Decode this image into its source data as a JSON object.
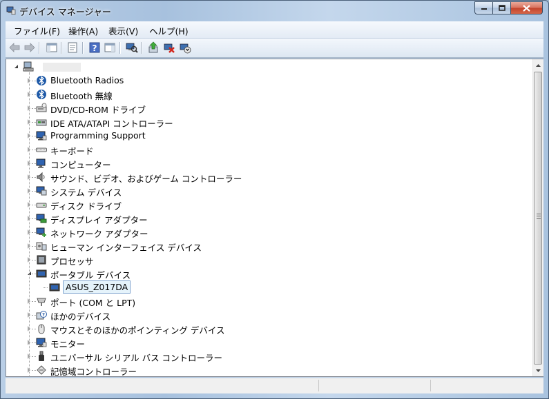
{
  "window": {
    "title": "デバイス マネージャー",
    "controls": {
      "minimize_icon": "minimize-icon",
      "maximize_icon": "maximize-icon",
      "close_icon": "close-icon"
    }
  },
  "menu": [
    {
      "id": "file",
      "label": "ファイル(F)"
    },
    {
      "id": "action",
      "label": "操作(A)"
    },
    {
      "id": "view",
      "label": "表示(V)"
    },
    {
      "id": "help",
      "label": "ヘルプ(H)"
    }
  ],
  "toolbar": [
    {
      "id": "back",
      "icon": "back-arrow-icon"
    },
    {
      "id": "forward",
      "icon": "forward-arrow-icon"
    },
    {
      "id": "show-hide-console-tree",
      "icon": "console-tree-icon"
    },
    {
      "id": "properties",
      "icon": "properties-icon"
    },
    {
      "id": "help",
      "icon": "help-icon"
    },
    {
      "id": "show-action-pane",
      "icon": "action-pane-icon"
    },
    {
      "id": "scan-hardware",
      "icon": "scan-hardware-icon"
    },
    {
      "id": "update-driver",
      "icon": "update-driver-icon"
    },
    {
      "id": "uninstall",
      "icon": "uninstall-icon"
    },
    {
      "id": "enable-device",
      "icon": "enable-device-icon"
    }
  ],
  "tree": {
    "root_label": "",
    "items": [
      {
        "label": "Bluetooth Radios",
        "icon": "bluetooth-icon",
        "state": "collapsed"
      },
      {
        "label": "Bluetooth 無線",
        "icon": "bluetooth-icon",
        "state": "collapsed"
      },
      {
        "label": "DVD/CD-ROM ドライブ",
        "icon": "dvd-drive-icon",
        "state": "collapsed"
      },
      {
        "label": "IDE ATA/ATAPI コントローラー",
        "icon": "ide-controller-icon",
        "state": "collapsed"
      },
      {
        "label": "Programming Support",
        "icon": "monitor-icon",
        "state": "collapsed"
      },
      {
        "label": "キーボード",
        "icon": "keyboard-icon",
        "state": "collapsed"
      },
      {
        "label": "コンピューター",
        "icon": "computer-icon",
        "state": "collapsed"
      },
      {
        "label": "サウンド、ビデオ、およびゲーム コントローラー",
        "icon": "speaker-icon",
        "state": "collapsed"
      },
      {
        "label": "システム デバイス",
        "icon": "system-device-icon",
        "state": "collapsed"
      },
      {
        "label": "ディスク ドライブ",
        "icon": "disk-drive-icon",
        "state": "collapsed"
      },
      {
        "label": "ディスプレイ アダプター",
        "icon": "display-adapter-icon",
        "state": "collapsed"
      },
      {
        "label": "ネットワーク アダプター",
        "icon": "network-adapter-icon",
        "state": "collapsed"
      },
      {
        "label": "ヒューマン インターフェイス デバイス",
        "icon": "hid-icon",
        "state": "collapsed"
      },
      {
        "label": "プロセッサ",
        "icon": "processor-icon",
        "state": "collapsed"
      },
      {
        "label": "ポータブル デバイス",
        "icon": "portable-device-icon",
        "state": "expanded"
      },
      {
        "label": "ASUS_Z017DA",
        "icon": "portable-device-icon",
        "state": "child",
        "selected": true
      },
      {
        "label": "ポート (COM と LPT)",
        "icon": "port-icon",
        "state": "collapsed"
      },
      {
        "label": "ほかのデバイス",
        "icon": "unknown-device-icon",
        "state": "collapsed"
      },
      {
        "label": "マウスとそのほかのポインティング デバイス",
        "icon": "mouse-icon",
        "state": "collapsed"
      },
      {
        "label": "モニター",
        "icon": "monitor-icon",
        "state": "collapsed"
      },
      {
        "label": "ユニバーサル シリアル バス コントローラー",
        "icon": "usb-icon",
        "state": "collapsed"
      },
      {
        "label": "記憶域コントローラー",
        "icon": "storage-controller-icon",
        "state": "collapsed"
      }
    ]
  },
  "colors": {
    "selection_border": "#7da2ce",
    "selection_fill": "#e5f3fb"
  }
}
